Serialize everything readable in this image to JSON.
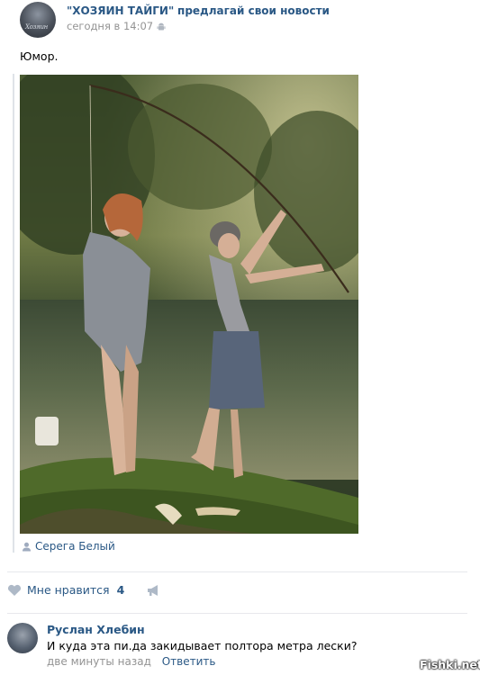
{
  "post": {
    "group_name": "\"ХОЗЯИН ТАЙГИ\"",
    "group_suffix": "предлагай свои новости",
    "time": "сегодня в 14:07",
    "text": "Юмор.",
    "signer": "Серега Белый"
  },
  "actions": {
    "like_label": "Мне нравится",
    "like_count": "4"
  },
  "comment": {
    "author": "Руслан Хлебин",
    "text": "И куда эта пи.да закидывает полтора метра лески?",
    "time": "две минуты назад",
    "reply_label": "Ответить"
  },
  "watermark": "Fishki.net",
  "colors": {
    "link": "#2a5885",
    "meta": "#939393",
    "divider": "#e7e8ec"
  }
}
